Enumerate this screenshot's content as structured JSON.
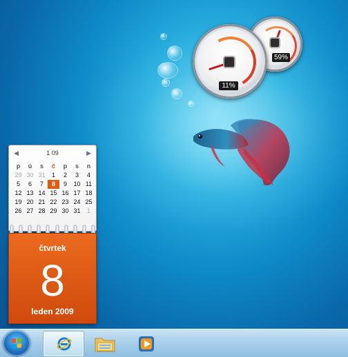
{
  "cpu_gauge": {
    "percent_label": "11%",
    "value_percent": 11
  },
  "memory_gauge": {
    "percent_label": "59%",
    "value_percent": 59
  },
  "calendar": {
    "month_label": "1 09",
    "weekday_headers": [
      "p",
      "ú",
      "s",
      "č",
      "p",
      "s",
      "n"
    ],
    "weeks": [
      [
        "29",
        "30",
        "31",
        "1",
        "2",
        "3",
        "4"
      ],
      [
        "5",
        "6",
        "7",
        "8",
        "9",
        "10",
        "11"
      ],
      [
        "12",
        "13",
        "14",
        "15",
        "16",
        "17",
        "18"
      ],
      [
        "19",
        "20",
        "21",
        "22",
        "23",
        "24",
        "25"
      ],
      [
        "26",
        "27",
        "28",
        "29",
        "30",
        "31",
        "1"
      ]
    ],
    "today": "8",
    "weekday_name": "čtvrtek",
    "day_number": "8",
    "month_year": "leden 2009",
    "accent_color": "#e05a12"
  },
  "taskbar": {
    "items": [
      {
        "name": "start-button",
        "icon": "windows-logo-icon"
      },
      {
        "name": "internet-explorer",
        "icon": "internet-explorer-icon",
        "active": true
      },
      {
        "name": "windows-explorer",
        "icon": "folder-icon"
      },
      {
        "name": "windows-media-player",
        "icon": "media-player-icon"
      }
    ]
  }
}
